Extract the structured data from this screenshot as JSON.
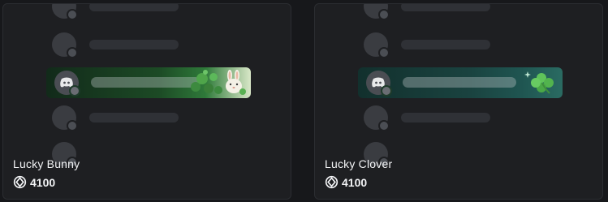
{
  "items": [
    {
      "name": "Lucky Bunny",
      "price": "4100",
      "decoration": "bunny-clover-nameplate"
    },
    {
      "name": "Lucky Clover",
      "price": "4100",
      "decoration": "clover-nameplate"
    }
  ],
  "colors": {
    "background": "#17181b",
    "card": "#1e1f22",
    "text": "#f2f3f5",
    "bunny_plate": "#2f7a3a",
    "clover_plate": "#1f5551"
  },
  "icons": {
    "currency": "orb-icon",
    "avatar": "discord-avatar-icon",
    "bunny": "bunny-icon",
    "clover": "clover-icon"
  }
}
